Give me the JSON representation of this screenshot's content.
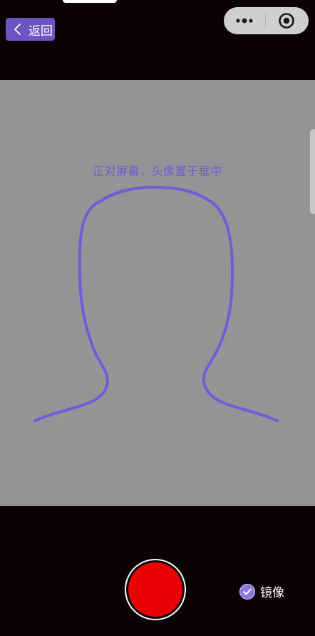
{
  "header": {
    "back_label": "返回",
    "back_icon": "chevron-left-icon",
    "capsule_more_icon": "more-dots-icon",
    "capsule_close_icon": "target-close-icon"
  },
  "camera": {
    "hint": "正对屏幕，头像置于框中",
    "outline_color": "#6b5fd6"
  },
  "controls": {
    "record_color": "#e80203",
    "mirror_label": "镜像",
    "mirror_checked": true,
    "mirror_check_color": "#8a78e0"
  },
  "colors": {
    "accent": "#6a55c2",
    "background": "#0a0203",
    "camera_bg": "#959396"
  }
}
